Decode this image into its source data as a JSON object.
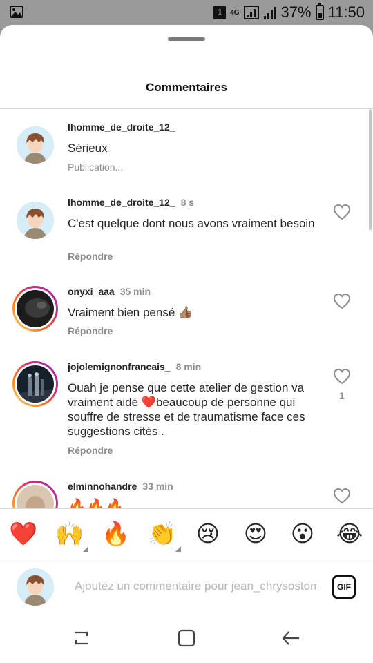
{
  "status_bar": {
    "sim_label": "1",
    "network_label": "4G",
    "battery_percent": "37%",
    "time": "11:50",
    "icons": [
      "image-icon",
      "sim-icon",
      "signal-icon",
      "battery-icon"
    ]
  },
  "sheet": {
    "title": "Commentaires"
  },
  "comments": [
    {
      "username": "lhomme_de_droite_12_",
      "time": "",
      "text": "Sérieux",
      "status": "Publication...",
      "likes": ""
    },
    {
      "username": "lhomme_de_droite_12_",
      "time": "8 s",
      "text": "C'est quelque dont nous avons vraiment besoin",
      "reply_label": "Répondre",
      "likes": ""
    },
    {
      "username": "onyxi_aaa",
      "time": "35 min",
      "text": "Vraiment bien pensé 👍🏽",
      "reply_label": "Répondre",
      "likes": ""
    },
    {
      "username": "jojolemignonfrancais_",
      "time": "8 min",
      "text": "Ouah je pense que cette atelier de gestion va vraiment aidé ❤️beaucoup de personne qui souffre de stresse et de traumatisme face ces suggestions cités .",
      "reply_label": "Répondre",
      "likes": "1"
    },
    {
      "username": "elminnohandre",
      "time": "33 min",
      "text": "🔥🔥🔥",
      "likes": ""
    }
  ],
  "emoji_bar": [
    "❤️",
    "🙌",
    "🔥",
    "👏",
    "😢",
    "😍",
    "😮",
    "😂"
  ],
  "composer": {
    "placeholder": "Ajoutez un commentaire pour jean_chrysostome",
    "gif_label": "GIF"
  },
  "colors": {
    "text": "#262626",
    "secondary": "#8e8e8e",
    "like_heart": "#e0245e",
    "story_ring": [
      "#feda75",
      "#fa7e1e",
      "#d62976",
      "#962fbf"
    ]
  }
}
